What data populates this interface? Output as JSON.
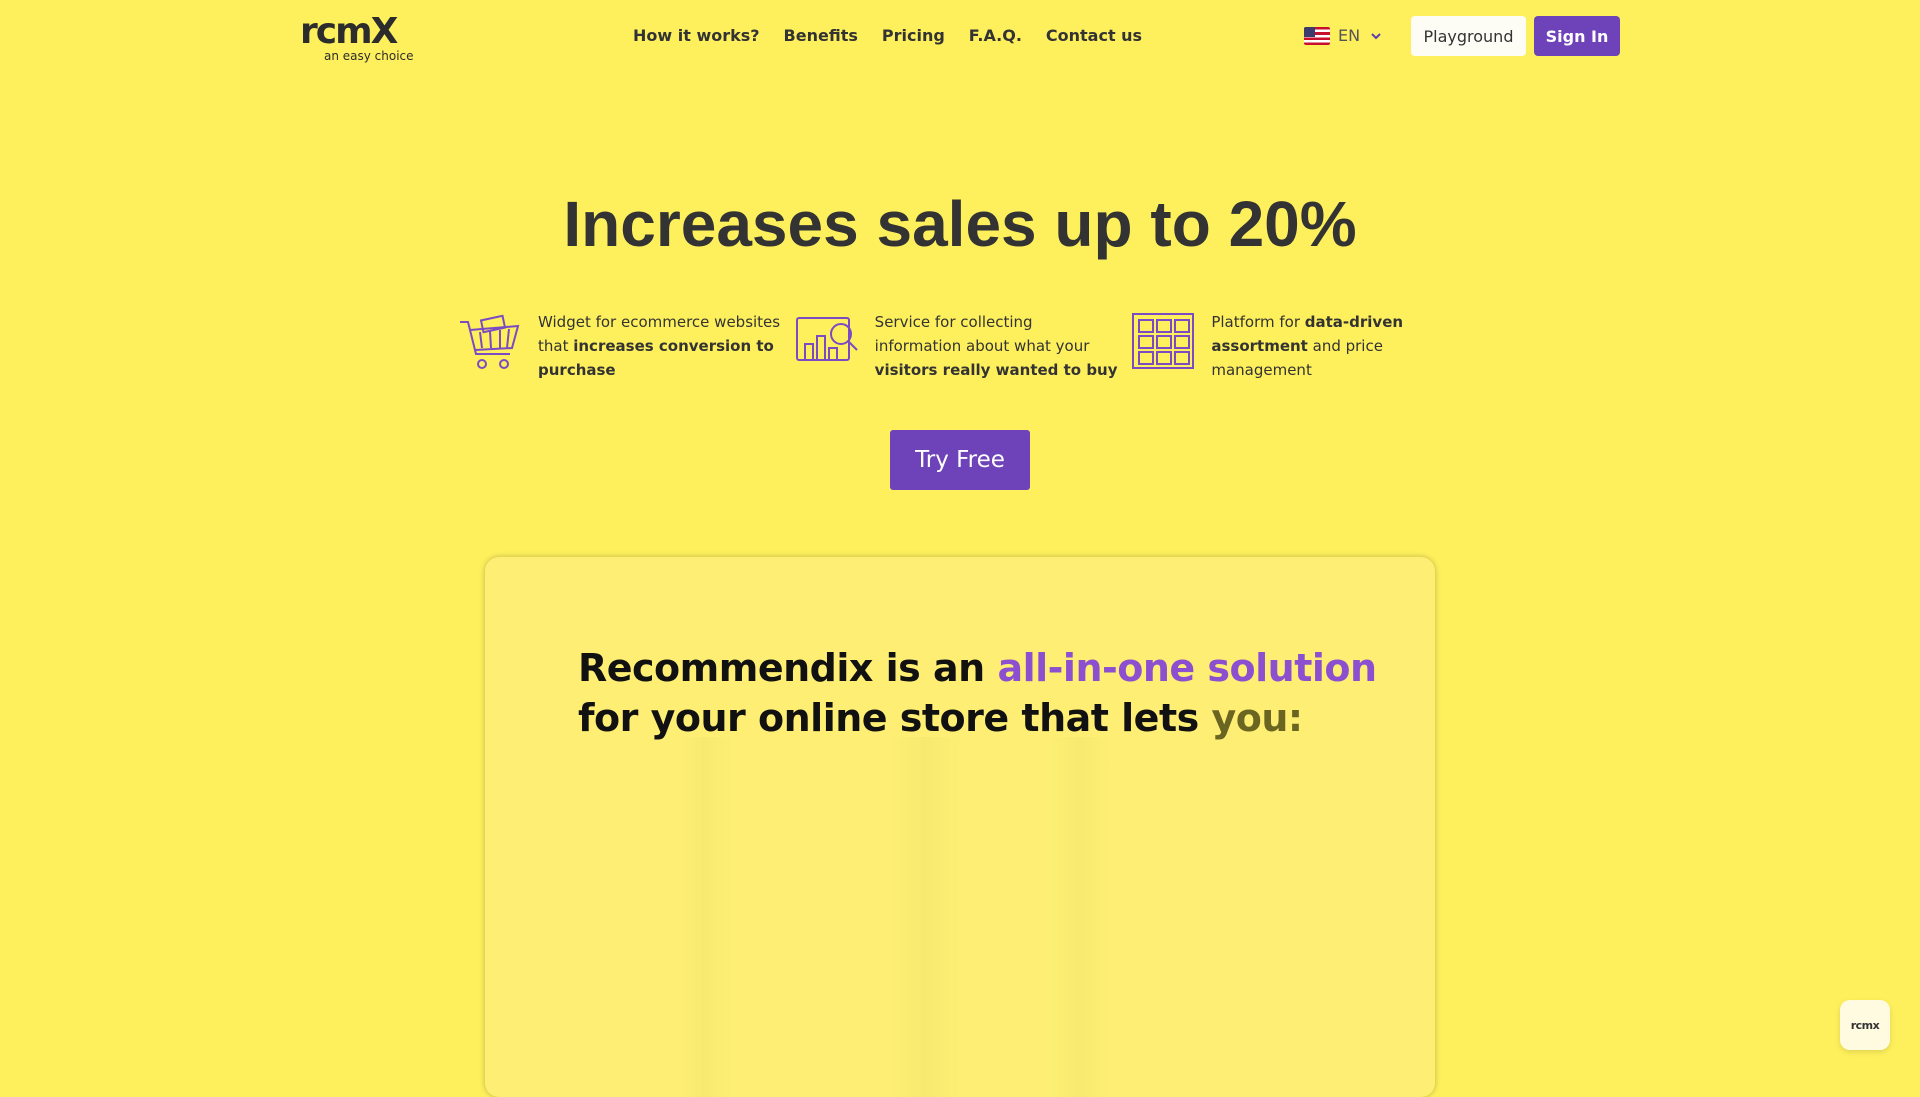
{
  "brand": {
    "logo_text": "rcmX",
    "tagline": "an easy choice"
  },
  "nav": {
    "items": [
      "How it works?",
      "Benefits",
      "Pricing",
      "F.A.Q.",
      "Contact us"
    ]
  },
  "language": {
    "code": "EN",
    "flag": "us-flag-icon"
  },
  "header_buttons": {
    "playground": "Playground",
    "sign_in": "Sign In"
  },
  "hero": {
    "title": "Increases sales up to 20%",
    "cta": "Try Free"
  },
  "features": [
    {
      "icon": "shopping-cart-icon",
      "pre": "Widget for ecommerce websites that ",
      "bold": "increases conversion to purchase",
      "post": ""
    },
    {
      "icon": "analytics-search-icon",
      "pre": "Service for collecting information about what your ",
      "bold": "visitors really wanted to buy",
      "post": ""
    },
    {
      "icon": "product-grid-icon",
      "pre": "Platform for ",
      "bold": "data-driven assortment",
      "post": " and price management"
    }
  ],
  "video": {
    "line1_a": "Recommendix is an ",
    "line1_b": "all-in-one solution",
    "line2_a": "for your online store that lets ",
    "line2_b": "you:"
  },
  "chat_widget": {
    "label": "rcmx"
  },
  "colors": {
    "background": "#fef05c",
    "primary": "#6e42b8",
    "accent_text": "#8c4fd0"
  }
}
